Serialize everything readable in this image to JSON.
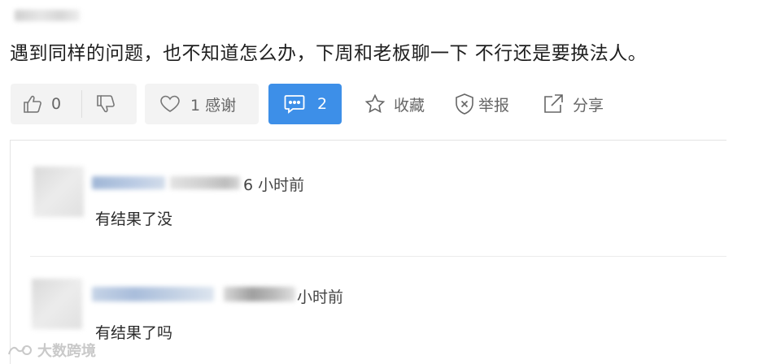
{
  "post": {
    "text": "遇到同样的问题，也不知道怎么办，下周和老板聊一下 不行还是要换法人。"
  },
  "actions": {
    "like_count": "0",
    "thanks_label": "1 感谢",
    "comment_count": "2",
    "favorite_label": "收藏",
    "report_label": "举报",
    "share_label": "分享",
    "accent_color": "#3d8fe8"
  },
  "comments": [
    {
      "time": "6 小时前",
      "text": "有结果了没"
    },
    {
      "time": "小时前",
      "text": "有结果了吗"
    }
  ],
  "watermark": "大数跨境"
}
